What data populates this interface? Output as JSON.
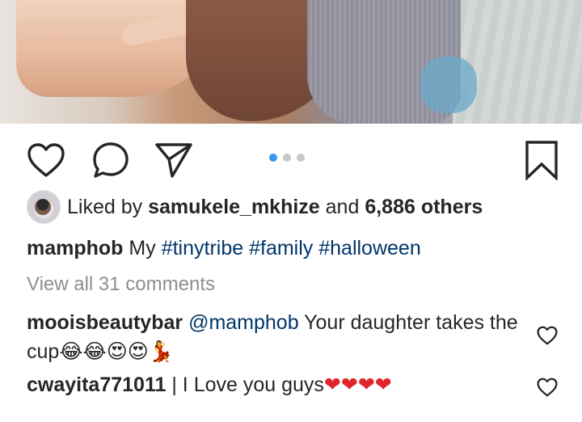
{
  "post": {
    "photo_alt": "",
    "carousel": {
      "count": 3,
      "active_index": 0
    },
    "likes": {
      "prefix": "Liked by",
      "user": "samukele_mkhize",
      "middle": "and",
      "count": "6,886 others"
    },
    "caption": {
      "user": "mamphob",
      "text_before": "My",
      "tags": [
        "#tinytribe",
        "#family",
        "#halloween"
      ]
    },
    "view_all": "View all 31 comments",
    "comments": [
      {
        "user": "mooisbeautybar",
        "mention": "@mamphob",
        "text": "Your daughter takes the cup",
        "emojis": "😂😂😍😍💃"
      },
      {
        "user": "cwayita771011",
        "text": "I Love you guys",
        "emojis": "❤❤❤❤"
      }
    ]
  },
  "icons": {
    "like": "heart-outline-icon",
    "comment": "comment-bubble-icon",
    "share": "paper-plane-icon",
    "save": "bookmark-icon",
    "comment_like": "small-heart-icon"
  },
  "colors": {
    "carousel_active": "#3897f0",
    "hashtag": "#003569",
    "muted": "#8e8e8e",
    "text": "#262626",
    "heart_emoji": "#e0242b"
  }
}
